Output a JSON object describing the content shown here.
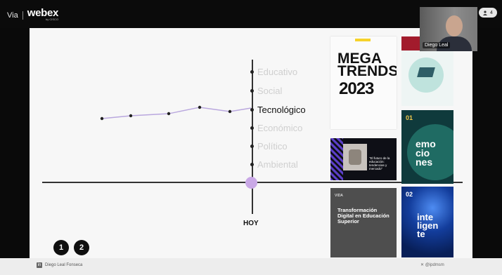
{
  "app": {
    "via": "Via",
    "brand": "webex",
    "brand_sub": "by CISCO",
    "participants_count": "4"
  },
  "video": {
    "name": "Diego Leal"
  },
  "timeline": {
    "categories": [
      "Educativo",
      "Social",
      "Tecnológico",
      "Económico",
      "Político",
      "Ambiental"
    ],
    "active_index": 2,
    "today_label": "HOY",
    "accent": "#c9a8e6"
  },
  "cards": {
    "mega_title_1": "MEGA",
    "mega_title_2": "TRENDS",
    "mega_year": "2023",
    "emociones_num": "01",
    "emociones": [
      "emo",
      "cio",
      "nes"
    ],
    "futuro_text": "\"El futuro de la educación: tendencias y mercado\"",
    "transformacion_hd": "VIDA",
    "transformacion": "Transformación Digital en Educación Superior",
    "inteligente_num": "02",
    "inteligente": [
      "inte",
      "ligen",
      "te"
    ]
  },
  "pagination": {
    "p1": "1",
    "p2": "2"
  },
  "footer": {
    "linkedin": "Diego Leal Fonseca",
    "twitter": "@ipdmsm"
  }
}
